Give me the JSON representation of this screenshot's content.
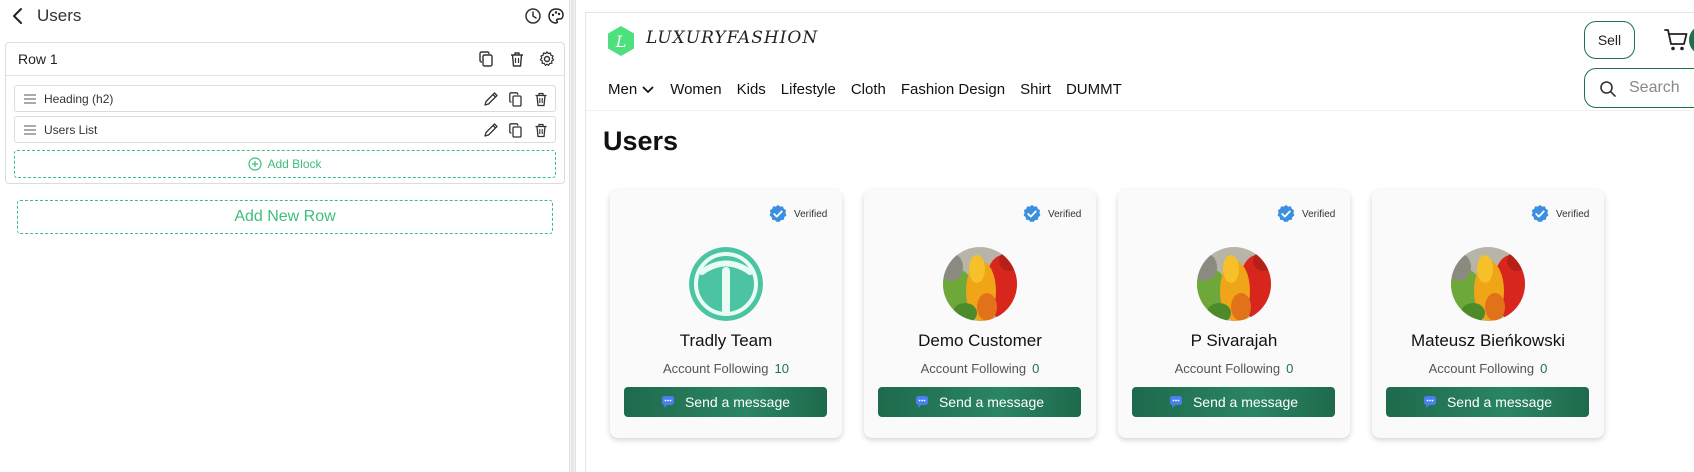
{
  "editor": {
    "title": "Users",
    "rows": [
      {
        "title": "Row 1",
        "blocks": [
          {
            "label": "Heading (h2)"
          },
          {
            "label": "Users List"
          }
        ],
        "add_block_label": "Add Block"
      }
    ],
    "add_row_label": "Add New Row"
  },
  "preview": {
    "logo_letter": "L",
    "logo_text": "LUXURYFASHION",
    "sell_label": "Sell",
    "nav": [
      "Men",
      "Women",
      "Kids",
      "Lifestyle",
      "Cloth",
      "Fashion Design",
      "Shirt",
      "DUMMT"
    ],
    "search_placeholder": "Search",
    "page_title": "Users",
    "cards": [
      {
        "name": "Tradly Team",
        "following_label": "Account Following",
        "following": "10",
        "verified_label": "Verified",
        "button_label": "Send a message",
        "avatar": "tradly-logo"
      },
      {
        "name": "Demo Customer",
        "following_label": "Account Following",
        "following": "0",
        "verified_label": "Verified",
        "button_label": "Send a message",
        "avatar": "peppers-photo"
      },
      {
        "name": "P Sivarajah",
        "following_label": "Account Following",
        "following": "0",
        "verified_label": "Verified",
        "button_label": "Send a message",
        "avatar": "peppers-photo"
      },
      {
        "name": "Mateusz Bieńkowski",
        "following_label": "Account Following",
        "following": "0",
        "verified_label": "Verified",
        "button_label": "Send a message",
        "avatar": "peppers-photo"
      }
    ]
  },
  "colors": {
    "accent_green": "#3cbf7a",
    "brand_dark_green": "#1f6f52",
    "verified_blue": "#3a8fe0"
  }
}
